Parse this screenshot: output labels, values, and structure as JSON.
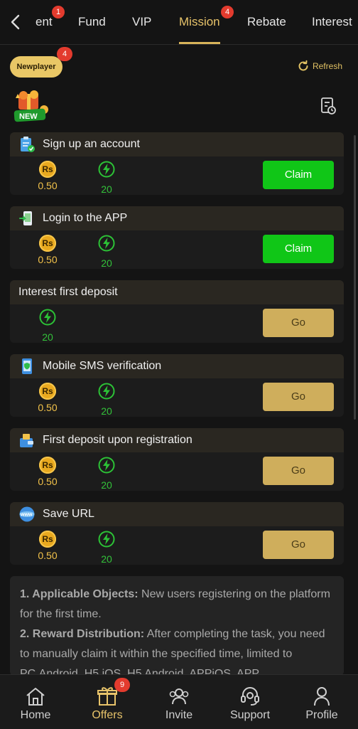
{
  "tabs": [
    {
      "label": "ent",
      "badge": "1"
    },
    {
      "label": "Fund"
    },
    {
      "label": "VIP"
    },
    {
      "label": "Mission",
      "badge": "4",
      "active": true
    },
    {
      "label": "Rebate"
    },
    {
      "label": "Interest"
    }
  ],
  "filter": {
    "chip_label": "Newplayer",
    "chip_badge": "4",
    "refresh_label": "Refresh",
    "logo_text": "NEW"
  },
  "tasks": [
    {
      "title": "Sign up an account",
      "money": "0.50",
      "exp": "20",
      "button": "Claim",
      "icon": "clipboard-icon"
    },
    {
      "title": "Login to the APP",
      "money": "0.50",
      "exp": "20",
      "button": "Claim",
      "icon": "phone-login-icon"
    },
    {
      "title": "Interest first deposit",
      "exp": "20",
      "button": "Go"
    },
    {
      "title": "Mobile SMS verification",
      "money": "0.50",
      "exp": "20",
      "button": "Go",
      "icon": "phone-shield-icon"
    },
    {
      "title": "First deposit upon registration",
      "money": "0.50",
      "exp": "20",
      "button": "Go",
      "icon": "wallet-icon"
    },
    {
      "title": "Save URL",
      "money": "0.50",
      "exp": "20",
      "button": "Go",
      "icon": "www-globe-icon"
    }
  ],
  "coin_symbol": "Rs",
  "rules": {
    "items": [
      {
        "heading": "1. Applicable Objects:",
        "text": " New users registering on the platform for the first time."
      },
      {
        "heading": "2. Reward Distribution:",
        "text": " After completing the task, you need to manually claim it within the specified time, limited to PC,Android, H5,iOS, H5 Android, APPiOS, APP"
      }
    ]
  },
  "bottom_nav": [
    {
      "label": "Home"
    },
    {
      "label": "Offers",
      "badge": "9",
      "active": true
    },
    {
      "label": "Invite"
    },
    {
      "label": "Support"
    },
    {
      "label": "Profile"
    }
  ],
  "colors": {
    "accent": "#e7c36a",
    "claim": "#10c617",
    "go": "#cfae5c",
    "badge": "#e33b2e",
    "background": "#141414"
  }
}
